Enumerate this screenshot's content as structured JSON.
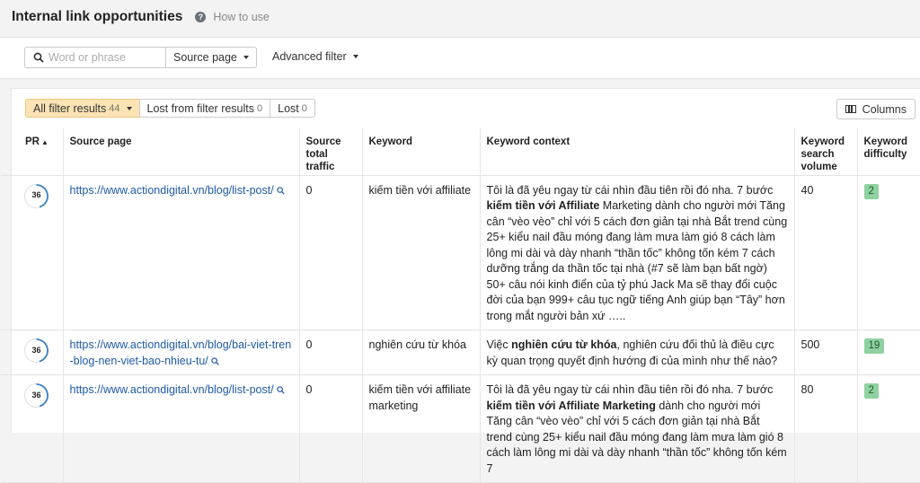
{
  "header": {
    "title": "Internal link opportunities",
    "help_label": "How to use",
    "help_icon_text": "?"
  },
  "filters": {
    "search_placeholder": "Word or phrase",
    "source_page_label": "Source page",
    "advanced_filter_label": "Advanced filter"
  },
  "tabs": [
    {
      "label": "All filter results",
      "count": "44"
    },
    {
      "label": "Lost from filter results",
      "count": "0"
    },
    {
      "label": "Lost",
      "count": "0"
    }
  ],
  "columns_button": "Columns",
  "table": {
    "headers": {
      "pr": "PR",
      "pr_sort": "▲",
      "source_page": "Source page",
      "source_traffic": "Source total traffic",
      "keyword": "Keyword",
      "context": "Keyword context",
      "volume": "Keyword search volume",
      "difficulty": "Keyword difficulty"
    },
    "rows": [
      {
        "pr": "36",
        "url": "https://www.actiondigital.vn/blog/list-post/",
        "traffic": "0",
        "keyword": "kiếm tiền với affiliate",
        "context_pre": "Tôi là đã yêu ngay từ cái nhìn đầu tiên rồi đó nha. 7 bước ",
        "context_bold": "kiếm tiền với Affiliate",
        "context_post": " Marketing dành cho người mới Tăng cân “vèo vèo” chỉ với  5 cách  đơn giản tại nhà Bắt trend cùng  25+ kiểu  nail đầu móng đang làm mưa làm gió 8 cách làm lông mi dài và dày nhanh “thần tốc” không tốn kém 7 cách  dưỡng trắng da thần tốc tại nhà (#7 sẽ làm bạn bất ngờ) 50+ câu nói  kinh điển của tỷ phú Jack Ma sẽ thay đổi cuộc đời của bạn 999+ câu tục ngữ  tiếng Anh giúp bạn “Tây” hơn trong mắt người bản xứ …..",
        "volume": "40",
        "kd": "2"
      },
      {
        "pr": "36",
        "url": "https://www.actiondigital.vn/blog/bai-viet-tren-blog-nen-viet-bao-nhieu-tu/",
        "traffic": "0",
        "keyword": "nghiên cứu từ khóa",
        "context_pre": "Việc ",
        "context_bold": "nghiên cứu từ khóa",
        "context_post": ", nghiên cứu đối thủ là điều cực kỳ quan trọng quyết định hướng đi của mình như thế nào?",
        "volume": "500",
        "kd": "19"
      },
      {
        "pr": "36",
        "url": "https://www.actiondigital.vn/blog/list-post/",
        "traffic": "0",
        "keyword": "kiếm tiền với affiliate marketing",
        "context_pre": "Tôi là đã yêu ngay từ cái nhìn đầu tiên rồi đó nha. 7 bước ",
        "context_bold": "kiếm tiền với Affiliate Marketing",
        "context_post": " dành cho người mới Tăng cân “vèo vèo” chỉ với  5 cách  đơn giản tại nhà Bắt trend cùng  25+ kiểu  nail đầu móng đang làm mưa làm gió 8 cách làm lông mi dài và dày nhanh “thần tốc” không tốn kém 7",
        "volume": "80",
        "kd": "2"
      }
    ]
  },
  "colors": {
    "active_tab": "#fbe3b3",
    "link": "#1f5ba8",
    "kd_badge": "#8fd1a0",
    "pr_ring": "#3b82c4"
  },
  "icons": [
    "help-icon",
    "search-icon",
    "caret-down-icon",
    "columns-icon",
    "magnifier-icon",
    "pr-ring-icon"
  ]
}
